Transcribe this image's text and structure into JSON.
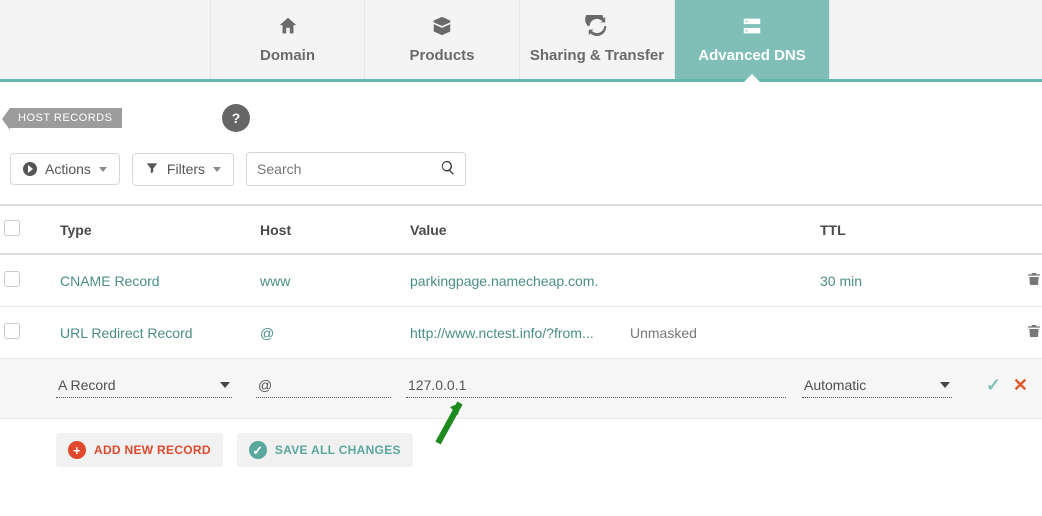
{
  "tabs": {
    "domain": "Domain",
    "products": "Products",
    "sharing": "Sharing & Transfer",
    "advanced": "Advanced DNS"
  },
  "section": {
    "label": "HOST RECORDS",
    "help": "?"
  },
  "toolbar": {
    "actions": "Actions",
    "filters": "Filters",
    "search_placeholder": "Search"
  },
  "columns": {
    "type": "Type",
    "host": "Host",
    "value": "Value",
    "ttl": "TTL"
  },
  "rows": [
    {
      "type": "CNAME Record",
      "host": "www",
      "value": "parkingpage.namecheap.com.",
      "extra": "",
      "ttl": "30 min"
    },
    {
      "type": "URL Redirect Record",
      "host": "@",
      "value": "http://www.nctest.info/?from...",
      "extra": "Unmasked",
      "ttl": ""
    }
  ],
  "edit": {
    "type": "A Record",
    "host": "@",
    "value": "127.0.0.1",
    "ttl": "Automatic"
  },
  "footer": {
    "add": "ADD NEW RECORD",
    "save": "SAVE ALL CHANGES"
  }
}
